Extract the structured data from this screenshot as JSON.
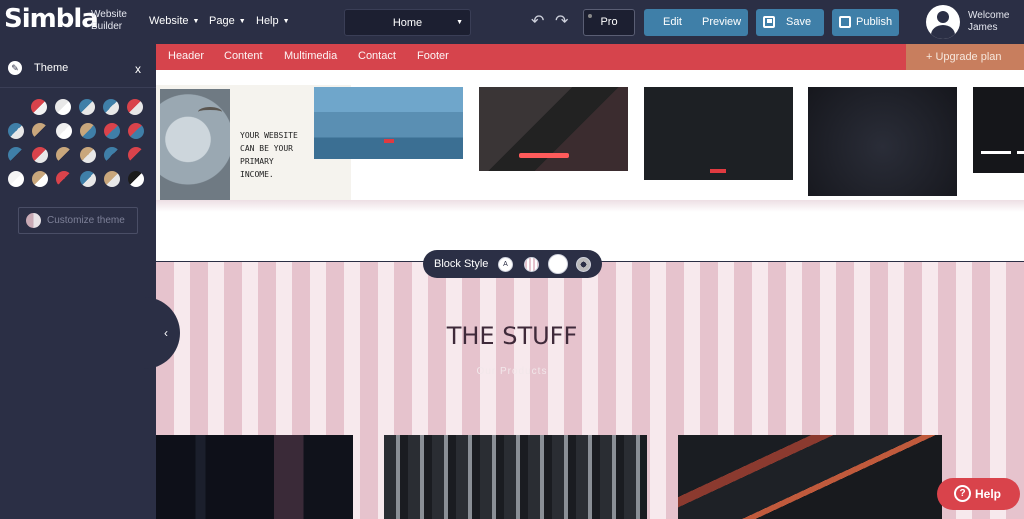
{
  "app": {
    "logo": "Simbla",
    "logo_sub_1": "Website",
    "logo_sub_2": "Builder"
  },
  "menus": [
    {
      "label": "Website"
    },
    {
      "label": "Page"
    },
    {
      "label": "Help"
    }
  ],
  "page_select": {
    "value": "Home"
  },
  "toolbar": {
    "pro_label": "Pro",
    "edit_label": "Edit",
    "preview_label": "Preview",
    "save_label": "Save",
    "publish_label": "Publish"
  },
  "user": {
    "welcome": "Welcome",
    "name": "James"
  },
  "sidebar": {
    "title": "Theme",
    "close": "x",
    "customize_label": "Customize theme",
    "collapse_glyph": "‹"
  },
  "theme_swatches": [
    [
      "#d9434b",
      "#f3f3f3"
    ],
    [
      "#e8e8e8",
      "#ffffff"
    ],
    [
      "#3f7fa8",
      "#e8e8e8"
    ],
    [
      "#3f7fa8",
      "#e8e8e8"
    ],
    [
      "#d9434b",
      "#e8e8e8"
    ],
    [
      "#3f7fa8",
      "#e8e8e8"
    ],
    [
      "#c9a77c",
      "#2b2f45"
    ],
    [
      "#f0f0f0",
      "#ffffff"
    ],
    [
      "#c9a77c",
      "#3f7fa8"
    ],
    [
      "#d9434b",
      "#3f7fa8"
    ],
    [
      "#d9434b",
      "#3f7fa8"
    ],
    [
      "#3f7fa8",
      "#2b2f45"
    ],
    [
      "#d9434b",
      "#e8e8e8"
    ],
    [
      "#c9a77c",
      "#2b2f45"
    ],
    [
      "#c9a77c",
      "#e8e8e8"
    ],
    [
      "#3f7fa8",
      "#2b2f45"
    ],
    [
      "#d9434b",
      "#2b2f45"
    ],
    [
      "#f5f5f5",
      "#ffffff"
    ],
    [
      "#c9a77c",
      "#ffffff"
    ],
    [
      "#d9434b",
      "#2b2f45"
    ],
    [
      "#3f7fa8",
      "#e8e8e8"
    ],
    [
      "#c9a77c",
      "#e8e8e8"
    ],
    [
      "#1b1b1b",
      "#ffffff"
    ]
  ],
  "template_nav": {
    "items": [
      "Header",
      "Content",
      "Multimedia",
      "Contact",
      "Footer"
    ],
    "upgrade": "+ Upgrade plan"
  },
  "template_1_copy": "YOUR WEBSITE\nCAN BE YOUR\nPRIMARY\nINCOME.",
  "block_style": {
    "label": "Block Style"
  },
  "section": {
    "title": "THE STUFF",
    "subtitle": "Our Products"
  },
  "help": {
    "label": "Help",
    "glyph": "?"
  },
  "colors": {
    "dark": "#2b2f45",
    "accent_blue": "#3f7fa8",
    "nav_red": "#d6444c",
    "upgrade": "#c87e5e",
    "help_red": "#d9434b"
  }
}
